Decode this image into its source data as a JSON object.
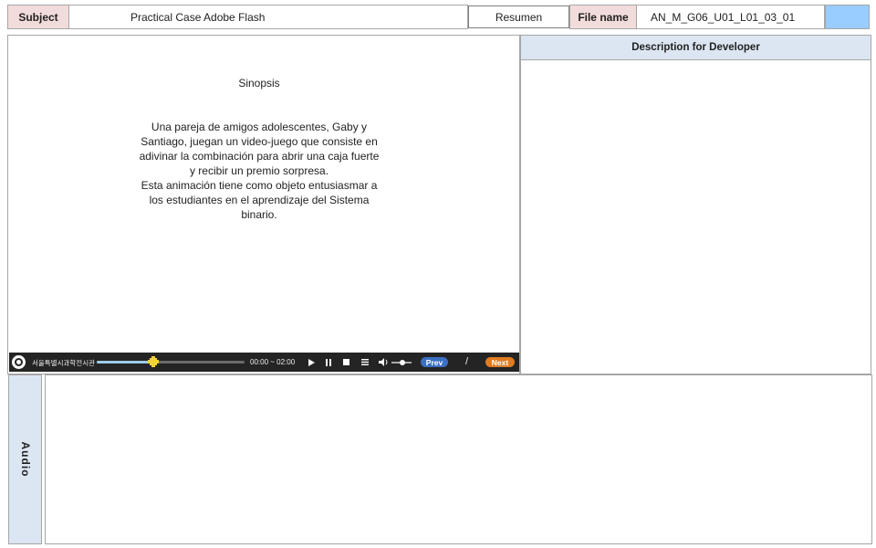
{
  "header": {
    "subject_label": "Subject",
    "subject_value": "Practical Case Adobe Flash",
    "resumen_label": "Resumen",
    "file_name_label": "File name",
    "file_name_value": "AN_M_G06_U01_L01_03_01"
  },
  "content": {
    "synopsis_title": "Sinopsis",
    "synopsis_p1": "Una pareja de amigos adolescentes, Gaby y Santiago, juegan un video-juego que consiste en adivinar la combinación para abrir una caja fuerte y recibir un premio sorpresa.",
    "synopsis_p2": "Esta animación tiene como objeto entusiasmar a los estudiantes en el aprendizaje del Sistema binario."
  },
  "player": {
    "brand_text": "서울특별시과학전시관",
    "time_display": "00:00 ~ 02:00",
    "progress": 0.38,
    "volume": 0.55,
    "prev_label": "Prev",
    "separator": "/",
    "next_label": "Next"
  },
  "developer_panel": {
    "title": "Description for Developer"
  },
  "audio": {
    "label": "Audio"
  },
  "colors": {
    "label_bg": "#f2dcdb",
    "desc_header_bg": "#dce6f2",
    "audio_label_bg": "#dce6f2",
    "accent_box": "#99ccff",
    "player_bg": "#242424",
    "prev_btn": "#3b6fc3",
    "next_btn": "#e07b1f"
  }
}
